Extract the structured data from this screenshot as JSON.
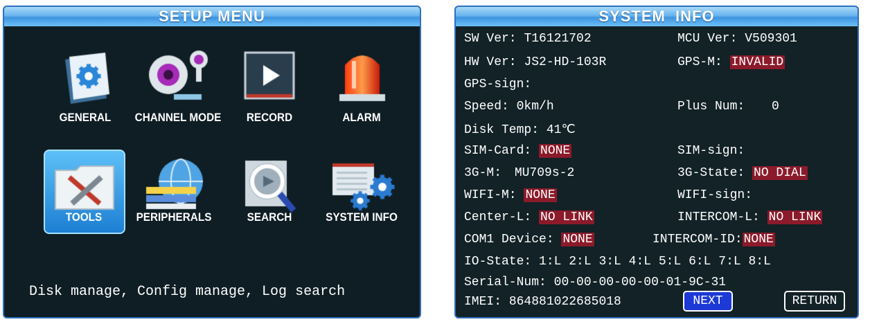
{
  "setup_menu": {
    "title": "SETUP MENU",
    "items": [
      {
        "label": "GENERAL",
        "icon": "document-gear-icon"
      },
      {
        "label": "CHANNEL MODE",
        "icon": "webcam-icon"
      },
      {
        "label": "RECORD",
        "icon": "video-play-icon"
      },
      {
        "label": "ALARM",
        "icon": "alarm-light-icon"
      },
      {
        "label": "TOOLS",
        "icon": "tools-icon",
        "selected": true
      },
      {
        "label": "PERIPHERALS",
        "icon": "globe-network-icon"
      },
      {
        "label": "SEARCH",
        "icon": "magnifier-icon"
      },
      {
        "label": "SYSTEM INFO",
        "icon": "system-gear-icon"
      }
    ],
    "status_text": "Disk manage, Config manage, Log search"
  },
  "system_info": {
    "title": "SYSTEM  INFO",
    "sw_ver_label": "SW Ver:",
    "sw_ver": "T16121702",
    "mcu_ver_label": "MCU Ver:",
    "mcu_ver": "V509301",
    "hw_ver_label": "HW Ver:",
    "hw_ver": "JS2-HD-103R",
    "gps_m_label": "GPS-M:",
    "gps_m": "INVALID",
    "gps_sign_label": "GPS-sign:",
    "speed_label": "Speed:",
    "speed": "0km/h",
    "plus_num_label": "Plus Num:",
    "plus_num": "0",
    "disk_temp_label": "Disk Temp:",
    "disk_temp": "41℃",
    "sim_card_label": "SIM-Card:",
    "sim_card": "NONE",
    "sim_sign_label": "SIM-sign:",
    "g3_m_label": "3G-M:",
    "g3_m": "MU709s-2",
    "g3_state_label": "3G-State:",
    "g3_state": "NO DIAL",
    "wifi_m_label": "WIFI-M:",
    "wifi_m": "NONE",
    "wifi_sign_label": "WIFI-sign:",
    "center_l_label": "Center-L:",
    "center_l": "NO LINK",
    "intercom_l_label": "INTERCOM-L:",
    "intercom_l": "NO LINK",
    "com1_label": "COM1 Device:",
    "com1": "NONE",
    "intercom_id_label": "INTERCOM-ID:",
    "intercom_id": "NONE",
    "io_state_label": "IO-State:",
    "io_state": "1:L 2:L 3:L 4:L 5:L 6:L 7:L 8:L",
    "serial_label": "Serial-Num:",
    "serial": "00-00-00-00-00-01-9C-31",
    "imei_label": "IMEI:",
    "imei": "864881022685018",
    "next_label": "NEXT",
    "return_label": "RETURN"
  },
  "colors": {
    "background": "#0f1e24",
    "titlebar": "#68b4ee",
    "warning_bg": "#8b1a2a",
    "selected_button": "#1d39d6"
  }
}
